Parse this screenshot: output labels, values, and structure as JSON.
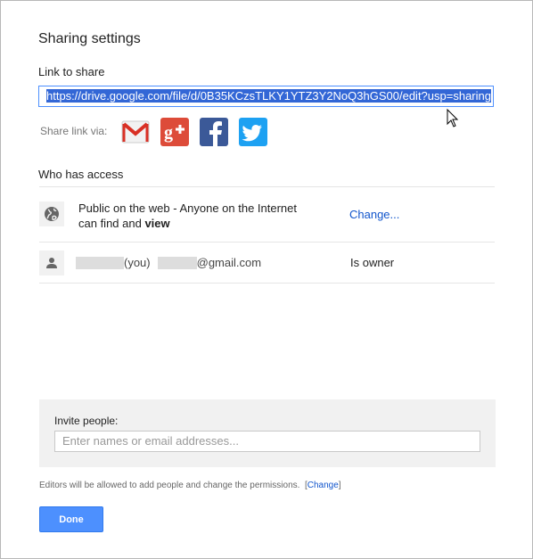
{
  "dialog": {
    "title": "Sharing settings",
    "link_label": "Link to share",
    "link_value": "https://drive.google.com/file/d/0B35KCzsTLKY1YTZ3Y2NoQ3hGS00/edit?usp=sharing",
    "share_via_label": "Share link via:",
    "share_targets": [
      "gmail-icon",
      "google-plus-icon",
      "facebook-icon",
      "twitter-icon"
    ]
  },
  "access": {
    "heading": "Who has access",
    "public": {
      "text_line1": "Public on the web - Anyone on the Internet",
      "text_line2_prefix": "can find and ",
      "text_line2_bold": "view",
      "change_label": "Change..."
    },
    "owner": {
      "you_label": "(you)",
      "email_suffix": "@gmail.com",
      "role": "Is owner"
    }
  },
  "invite": {
    "label": "Invite people:",
    "placeholder": "Enter names or email addresses..."
  },
  "footer": {
    "note": "Editors will be allowed to add people and change the permissions.",
    "note_link_open": "[",
    "note_link": "Change",
    "note_link_close": "]",
    "done_label": "Done"
  },
  "colors": {
    "accent": "#4d90fe",
    "link": "#1155cc",
    "selection": "#3367d6"
  }
}
